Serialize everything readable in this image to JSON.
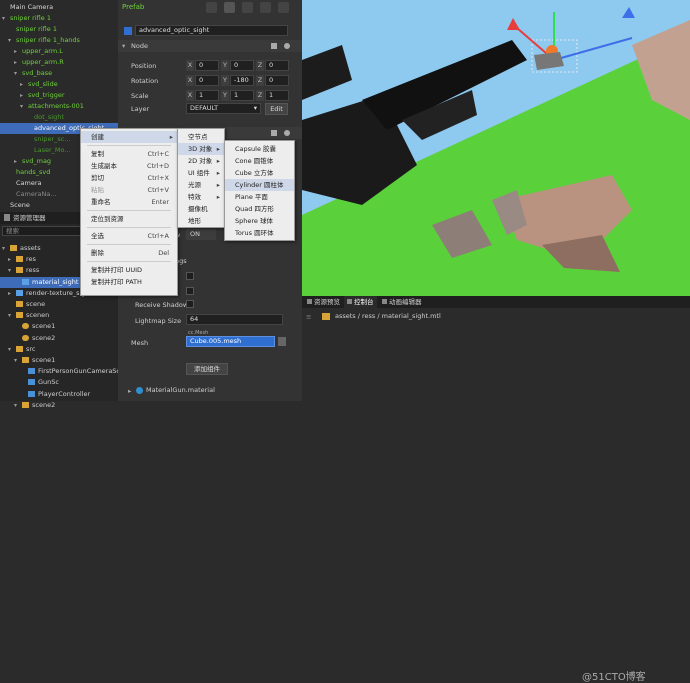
{
  "hierarchy": {
    "items": [
      {
        "label": "Main Camera",
        "indent": 0,
        "cls": "w"
      },
      {
        "label": "sniper rifle 1",
        "indent": 0,
        "cls": "g",
        "arrow": "▾"
      },
      {
        "label": "sniper rifle 1",
        "indent": 1,
        "cls": "g"
      },
      {
        "label": "sniper rifle 1_hands",
        "indent": 1,
        "cls": "g",
        "arrow": "▾"
      },
      {
        "label": "upper_arm.L",
        "indent": 2,
        "cls": "g",
        "arrow": "▸"
      },
      {
        "label": "upper_arm.R",
        "indent": 2,
        "cls": "g",
        "arrow": "▸"
      },
      {
        "label": "svd_base",
        "indent": 2,
        "cls": "g",
        "arrow": "▾"
      },
      {
        "label": "svd_slide",
        "indent": 3,
        "cls": "g",
        "arrow": "▸"
      },
      {
        "label": "svd_trigger",
        "indent": 3,
        "cls": "g",
        "arrow": "▸"
      },
      {
        "label": "attachments-001",
        "indent": 3,
        "cls": "g",
        "arrow": "▾"
      },
      {
        "label": "dot_sight",
        "indent": 4,
        "cls": "gd"
      },
      {
        "label": "advanced_optic_sight",
        "indent": 4,
        "cls": "w",
        "sel": true
      },
      {
        "label": "sniper_sc...",
        "indent": 4,
        "cls": "gd"
      },
      {
        "label": "Laser_Mo...",
        "indent": 4,
        "cls": "gd"
      },
      {
        "label": "svd_mag",
        "indent": 2,
        "cls": "g",
        "arrow": "▸"
      },
      {
        "label": "hands_svd",
        "indent": 1,
        "cls": "g"
      },
      {
        "label": "Camera",
        "indent": 1,
        "cls": "w"
      },
      {
        "label": "CameraNa...",
        "indent": 1,
        "cls": "dim"
      },
      {
        "label": "Scene",
        "indent": 0,
        "cls": "w"
      }
    ]
  },
  "assets_panel": {
    "title": "资源管理器",
    "search": "搜索",
    "items": [
      {
        "label": "assets",
        "indent": 0,
        "icon": "folder",
        "arrow": "▾"
      },
      {
        "label": "res",
        "indent": 1,
        "icon": "folder",
        "arrow": "▸"
      },
      {
        "label": "ress",
        "indent": 1,
        "icon": "folder",
        "arrow": "▾"
      },
      {
        "label": "material_sight",
        "indent": 2,
        "icon": "file",
        "sel": true
      },
      {
        "label": "render-texture_sight",
        "indent": 1,
        "icon": "file",
        "arrow": "▸"
      },
      {
        "label": "scene",
        "indent": 1,
        "icon": "folder"
      },
      {
        "label": "scenen",
        "indent": 1,
        "icon": "folder",
        "arrow": "▾"
      },
      {
        "label": "scene1",
        "indent": 2,
        "icon": "scene"
      },
      {
        "label": "scene2",
        "indent": 2,
        "icon": "scene"
      },
      {
        "label": "src",
        "indent": 1,
        "icon": "folder",
        "arrow": "▾"
      },
      {
        "label": "scene1",
        "indent": 2,
        "icon": "folder",
        "arrow": "▾"
      },
      {
        "label": "FirstPersonGunCameraSc",
        "indent": 3,
        "icon": "ts"
      },
      {
        "label": "GunSc",
        "indent": 3,
        "icon": "ts"
      },
      {
        "label": "PlayerController",
        "indent": 3,
        "icon": "ts"
      },
      {
        "label": "scene2",
        "indent": 2,
        "icon": "folder",
        "arrow": "▾"
      }
    ]
  },
  "inspector": {
    "prefab": "Prefab",
    "node_name": "advanced_optic_sight",
    "node_section": "Node",
    "position_label": "Position",
    "rotation_label": "Rotation",
    "scale_label": "Scale",
    "layer_label": "Layer",
    "position": [
      "0",
      "0",
      "0"
    ],
    "rotation": [
      "0",
      "-180",
      "0"
    ],
    "scale": [
      "1",
      "1",
      "1"
    ],
    "axes": [
      "X",
      "Y",
      "Z"
    ],
    "layer": "DEFAULT",
    "edit": "Edit",
    "receive_shadow": "Receive Shadow",
    "lightmap_size_label": "Lightmap Size",
    "lightmap_size": "64",
    "mesh_label": "Mesh",
    "mesh_value": "Cube.005.mesh",
    "mesh_tag": "cc.Mesh",
    "add_component": "添加组件",
    "material": "MaterialGun.material",
    "partial_aw": "w",
    "partial_on": "ON",
    "partial_ngs": "ngs"
  },
  "context_menu": {
    "items": [
      {
        "label": "创建",
        "sub": true,
        "hl": true
      },
      {
        "sep": true
      },
      {
        "label": "复制",
        "shortcut": "Ctrl+C"
      },
      {
        "label": "生成副本",
        "shortcut": "Ctrl+D"
      },
      {
        "label": "剪切",
        "shortcut": "Ctrl+X"
      },
      {
        "label": "粘贴",
        "shortcut": "Ctrl+V",
        "dis": true
      },
      {
        "label": "重命名",
        "shortcut": "Enter"
      },
      {
        "sep": true
      },
      {
        "label": "定位到资源"
      },
      {
        "sep": true
      },
      {
        "label": "全选",
        "shortcut": "Ctrl+A"
      },
      {
        "sep": true
      },
      {
        "label": "删除",
        "shortcut": "Del"
      },
      {
        "sep": true
      },
      {
        "label": "复制并打印 UUID"
      },
      {
        "label": "复制并打印 PATH"
      }
    ]
  },
  "create_submenu": {
    "items": [
      {
        "label": "空节点"
      },
      {
        "label": "3D 对象",
        "sub": true,
        "hl": true
      },
      {
        "label": "2D 对象",
        "sub": true
      },
      {
        "label": "UI 组件",
        "sub": true
      },
      {
        "label": "光源",
        "sub": true
      },
      {
        "label": "特效",
        "sub": true
      },
      {
        "label": "摄像机"
      },
      {
        "label": "地形"
      }
    ]
  },
  "objects_submenu": {
    "items": [
      {
        "label": "Capsule 胶囊"
      },
      {
        "label": "Cone 圆锥体"
      },
      {
        "label": "Cube 立方体"
      },
      {
        "label": "Cylinder 圆柱体",
        "hl": true
      },
      {
        "label": "Plane 平面"
      },
      {
        "label": "Quad 四方形"
      },
      {
        "label": "Sphere 球体"
      },
      {
        "label": "Torus 圆环体"
      }
    ]
  },
  "console": {
    "tabs": [
      "资源预览",
      "控制台",
      "动画编辑器"
    ],
    "path": "assets / ress / material_sight.mtl"
  },
  "watermark": "@51CTO博客",
  "colors": {
    "accent": "#2f6fd1",
    "green": "#6ed13a",
    "sky": "#8ec9f0",
    "grass": "#5ad13a"
  }
}
